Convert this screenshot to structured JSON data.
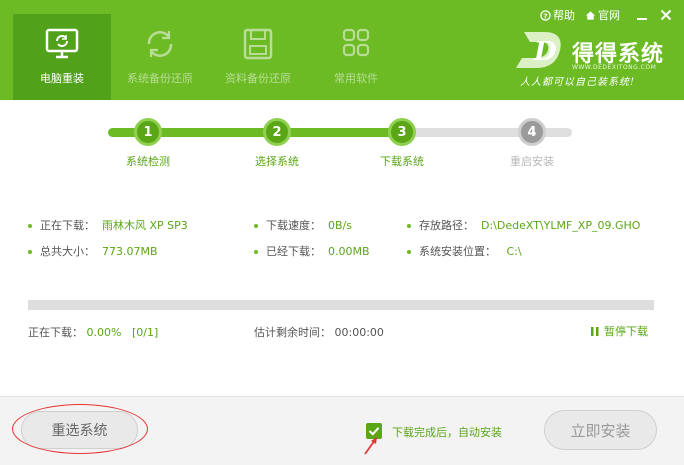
{
  "topbar": {
    "help_label": "帮助",
    "site_label": "官网"
  },
  "nav": {
    "tabs": [
      {
        "label": "电脑重装",
        "icon": "monitor-refresh-icon"
      },
      {
        "label": "系统备份还原",
        "icon": "refresh-arrows-icon"
      },
      {
        "label": "资料备份还原",
        "icon": "floppy-disk-icon"
      },
      {
        "label": "常用软件",
        "icon": "grid-apps-icon"
      }
    ]
  },
  "brand": {
    "name": "得得系统",
    "url": "WWW.DEDEXITONG.COM",
    "slogan": "人人都可以自己装系统!",
    "logo_letter": "D"
  },
  "steps": [
    {
      "num": "1",
      "label": "系统检测"
    },
    {
      "num": "2",
      "label": "选择系统"
    },
    {
      "num": "3",
      "label": "下载系统"
    },
    {
      "num": "4",
      "label": "重启安装"
    }
  ],
  "info": {
    "downloading_label": "正在下载：",
    "downloading_value": "雨林木风 XP SP3",
    "total_label": "总共大小：",
    "total_value": "773.07MB",
    "speed_label": "下载速度：",
    "speed_value": "0B/s",
    "downloaded_label": "已经下载：",
    "downloaded_value": "0.00MB",
    "path_label": "存放路径：",
    "path_value": "D:\\DedeXT\\YLMF_XP_09.GHO",
    "install_label": "系统安装位置：",
    "install_value": "C:\\"
  },
  "progress_fraction": 0.0,
  "status": {
    "downloading_label": "正在下载：",
    "percent": "0.00%",
    "count": "[0/1]",
    "remaining_label": "估计剩余时间：",
    "remaining_value": "00:00:00",
    "pause_label": "暂停下载"
  },
  "footer": {
    "reselect_label": "重选系统",
    "auto_install_label": "下载完成后，自动安装",
    "install_now_label": "立即安装"
  },
  "colors": {
    "accent": "#6cbb25",
    "accent_dark": "#52a11a",
    "inactive": "#a9a9a9",
    "annotation": "#e53535"
  }
}
